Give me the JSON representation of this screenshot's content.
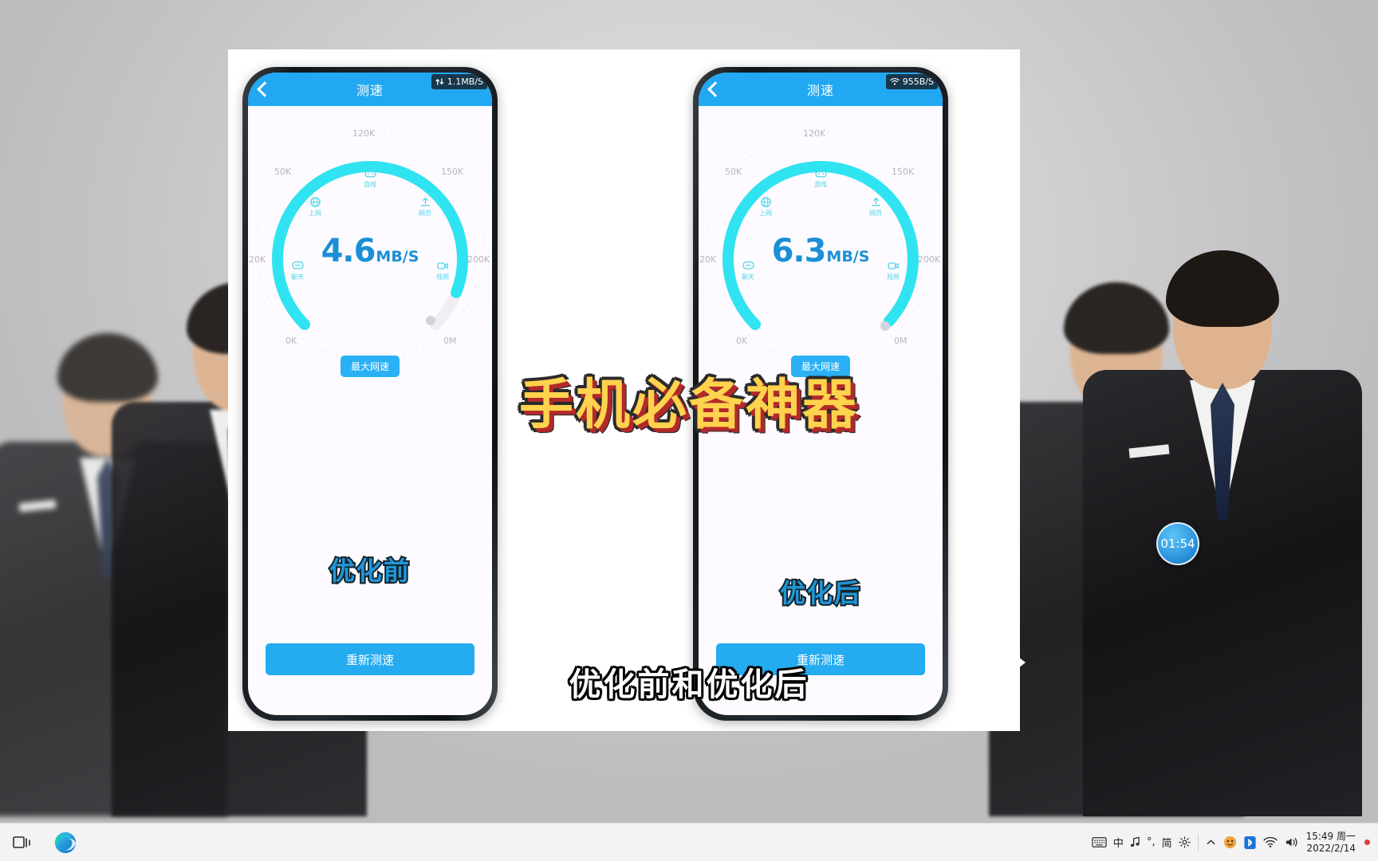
{
  "desktop": {
    "wallpaper_description": "studio photo of men in dark suits, grey backdrop"
  },
  "video": {
    "headline": "手机必备神器",
    "subtitle": "优化前和优化后",
    "timer_badge": "01:54",
    "play_arrow_icon": "play-arrow-icon"
  },
  "phones": [
    {
      "id": "before",
      "appbar": {
        "title": "测速",
        "back_icon": "chevron-left-icon"
      },
      "status": {
        "icon": "data-transfer-icon",
        "speed": "1.1MB/S"
      },
      "gauge": {
        "value": "4.6",
        "unit": "MB/S",
        "scale_labels": [
          "120K",
          "150K",
          "200K",
          "0M",
          "0K",
          "20K",
          "50K"
        ],
        "scale_positions": [
          "top",
          "top-right",
          "right",
          "bottom-right",
          "bottom-left",
          "left",
          "top-left"
        ],
        "arc_percent": 78,
        "spokes": [
          {
            "icon": "gamepad-icon",
            "label": "游戏"
          },
          {
            "icon": "upload-icon",
            "label": "网页"
          },
          {
            "icon": "globe-icon",
            "label": "上网"
          },
          {
            "icon": "chat-icon",
            "label": "聊天"
          },
          {
            "icon": "video-icon",
            "label": "视频"
          }
        ],
        "max_button": "最大网速"
      },
      "phase_label": "优化前",
      "retest_button": "重新测速"
    },
    {
      "id": "after",
      "appbar": {
        "title": "测速",
        "back_icon": "chevron-left-icon"
      },
      "status": {
        "icon": "wifi-icon",
        "speed": "955B/S"
      },
      "gauge": {
        "value": "6.3",
        "unit": "MB/S",
        "scale_labels": [
          "120K",
          "150K",
          "200K",
          "0M",
          "0K",
          "20K",
          "50K"
        ],
        "scale_positions": [
          "top",
          "top-right",
          "right",
          "bottom-right",
          "bottom-left",
          "left",
          "top-left"
        ],
        "arc_percent": 92,
        "spokes": [
          {
            "icon": "gamepad-icon",
            "label": "游戏"
          },
          {
            "icon": "upload-icon",
            "label": "网页"
          },
          {
            "icon": "globe-icon",
            "label": "上网"
          },
          {
            "icon": "chat-icon",
            "label": "聊天"
          },
          {
            "icon": "video-icon",
            "label": "视频"
          }
        ],
        "max_button": "最大网速"
      },
      "phase_label": "优化后",
      "retest_button": "重新测速"
    }
  ],
  "taskbar": {
    "apps": [
      {
        "name": "task-view-icon",
        "label": ""
      },
      {
        "name": "edge-browser-icon",
        "label": ""
      }
    ],
    "ime": {
      "layout_icon": "keyboard-icon",
      "language": "中",
      "music_icon": "music-note-icon",
      "degree_icon": "°,",
      "mode": "简",
      "settings_icon": "gear-icon"
    },
    "tray": {
      "chevron_icon": "chevron-up-icon",
      "app_icon": "tray-app-icon",
      "bluetooth_icon": "bluetooth-icon",
      "network_icon": "wifi-icon",
      "volume_icon": "speaker-icon"
    },
    "clock": {
      "time": "15:49 周一",
      "date": "2022/2/14"
    },
    "notification_dot_color": "#e03a3a"
  },
  "colors": {
    "appbar_blue": "#22a8f2",
    "gauge_cyan": "#30e3f0",
    "value_blue": "#1b8fd6",
    "headline_yellow": "#ffd34d",
    "headline_red_shadow": "#b3292a",
    "phase_blue": "#2196d6"
  }
}
